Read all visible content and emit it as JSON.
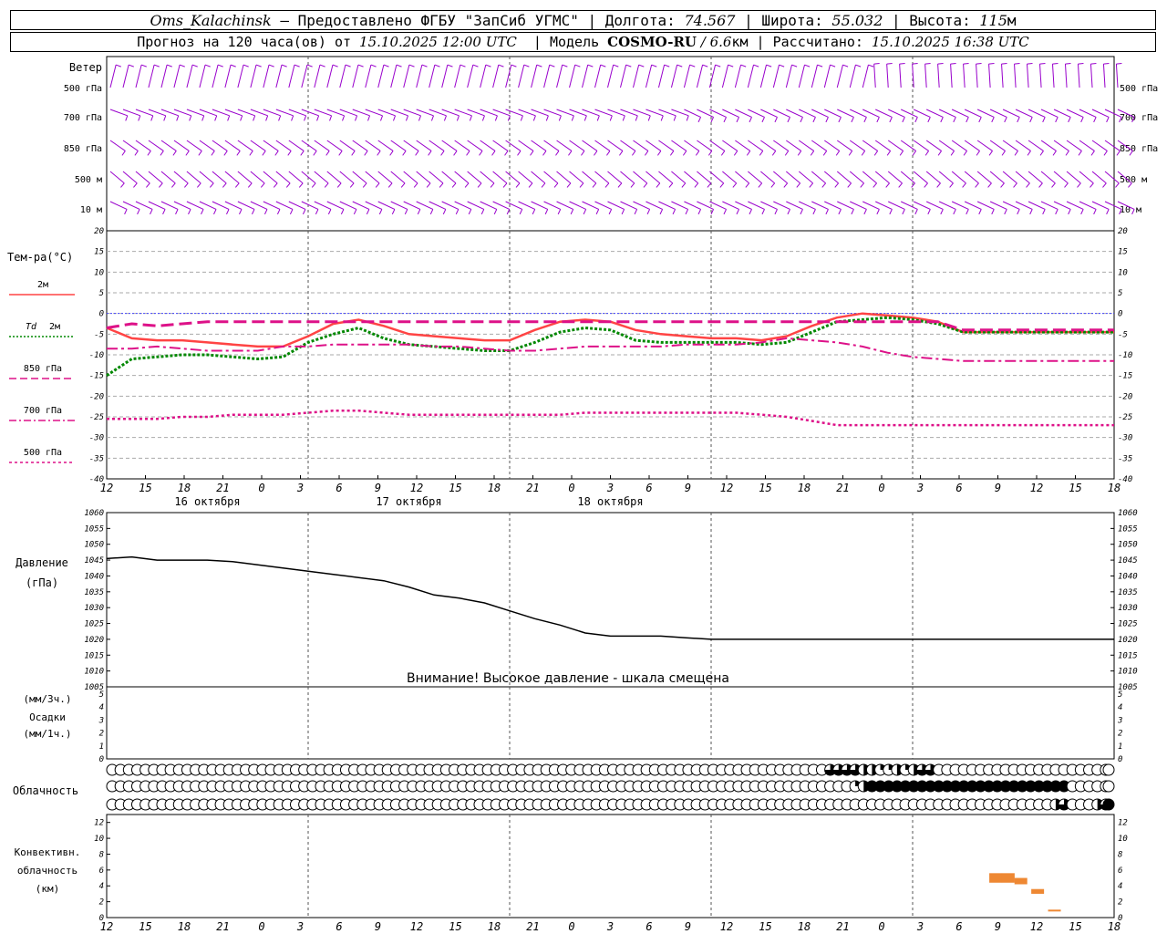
{
  "header": {
    "station": "Oms_Kalachinsk",
    "provider": " — Предоставлено ФГБУ \"ЗапСиб УГМС\" | Долгота: ",
    "lon": "74.567",
    "lat_label": " | Широта: ",
    "lat": "55.032",
    "alt_label": " | Высота: ",
    "alt": "115",
    "alt_unit": "м",
    "forecast_label": "Прогноз на 120 часа(ов) от ",
    "run_time": "15.10.2025 12:00 UTC",
    "model_label": "  | Модель ",
    "model": "COSMO-RU",
    "resolution": " / 6.6",
    "res_unit": "км",
    "calc_label": " | Рассчитано: ",
    "calc_time": "15.10.2025 16:38 UTC"
  },
  "labels": {
    "wind": "Ветер",
    "wind_levels": [
      "500 гПа",
      "700 гПа",
      "850 гПа",
      "500 м",
      "10 м"
    ],
    "temp_title": "Тем-ра(°С)",
    "legend_2m": "2м",
    "legend_td": "Td",
    "legend_td2": "2м",
    "legend_850": "850 гПа",
    "legend_700": "700 гПа",
    "legend_500": "500 гПа",
    "pressure_title": "Давление",
    "pressure_unit": "(гПа)",
    "warning": "Внимание! Высокое давление - шкала смещена",
    "precip_unit3": "(мм/3ч.)",
    "precip_title": "Осадки",
    "precip_unit1": "(мм/1ч.)",
    "cloud_title": "Облачность",
    "conv_title1": "Конвективн.",
    "conv_title2": "облачность",
    "conv_unit": "(км)"
  },
  "colors": {
    "t2m": "#ff4444",
    "td2m": "#008800",
    "t850": "#dd1188",
    "t700": "#dd1188",
    "t500": "#dd1188",
    "zero_line": "#4444ff",
    "wind": "#9900cc",
    "conv": "#ee8833"
  },
  "chart_data": [
    {
      "type": "line",
      "title": "Тем-ра(°С)",
      "x_hours": [
        0,
        3,
        6,
        9,
        12,
        15,
        18,
        21,
        24,
        27,
        30,
        33,
        36,
        39,
        42,
        45,
        48,
        51,
        54,
        57,
        60,
        63,
        66,
        69,
        72,
        75,
        78,
        81,
        84,
        87,
        90,
        93,
        96,
        99,
        102,
        105,
        108,
        111,
        114,
        117,
        120
      ],
      "x_ticks": [
        "12",
        "15",
        "18",
        "21",
        "0",
        "3",
        "6",
        "9",
        "12",
        "15",
        "18",
        "21",
        "0",
        "3",
        "6",
        "9",
        "12",
        "15",
        "18",
        "21",
        "0",
        "3",
        "6",
        "9",
        "12",
        "15",
        "18"
      ],
      "dates": [
        "16 октября",
        "17 октября",
        "18 октября"
      ],
      "ylim": [
        -40,
        20
      ],
      "yticks": [
        20,
        15,
        10,
        5,
        0,
        -5,
        -10,
        -15,
        -20,
        -25,
        -30,
        -35,
        -40
      ],
      "series": [
        {
          "name": "2м",
          "values": [
            -3.5,
            -6,
            -6.5,
            -6.5,
            -7,
            -7.5,
            -8,
            -8,
            -5.5,
            -2.5,
            -1.5,
            -3,
            -5,
            -5.5,
            -6,
            -6.5,
            -6.5,
            -4,
            -2,
            -1.5,
            -2,
            -4,
            -5,
            -5.5,
            -6,
            -6,
            -6.5,
            -5.5,
            -3,
            -1,
            0,
            -0.5,
            -1,
            -2,
            -4.5,
            -4.5,
            -4.5,
            -4.5,
            -4.5,
            -4.5,
            -4.5
          ]
        },
        {
          "name": "Td 2м",
          "values": [
            -15,
            -11,
            -10.5,
            -10,
            -10,
            -10.5,
            -11,
            -10.5,
            -7,
            -5,
            -3.5,
            -6,
            -7.5,
            -8,
            -8.5,
            -9,
            -9,
            -7,
            -4.5,
            -3.5,
            -4,
            -6.5,
            -7,
            -7,
            -7,
            -7,
            -7.5,
            -7,
            -4.5,
            -2,
            -1.5,
            -1,
            -1.5,
            -2.5,
            -4.5,
            -4.5,
            -4.5,
            -4.5,
            -4.5,
            -4.5,
            -4.5
          ]
        },
        {
          "name": "850 гПа",
          "values": [
            -3.5,
            -2.5,
            -3,
            -2.5,
            -2,
            -2,
            -2,
            -2,
            -2,
            -2,
            -2,
            -2,
            -2,
            -2,
            -2,
            -2,
            -2,
            -2,
            -2,
            -2,
            -2,
            -2,
            -2,
            -2,
            -2,
            -2,
            -2,
            -2,
            -2,
            -2,
            -2,
            -2,
            -2,
            -2,
            -4,
            -4,
            -4,
            -4,
            -4,
            -4,
            -4
          ]
        },
        {
          "name": "700 гПа",
          "values": [
            -8.5,
            -8.5,
            -8,
            -8.5,
            -9,
            -9,
            -9,
            -8,
            -8,
            -7.5,
            -7.5,
            -7.5,
            -7.5,
            -8,
            -8,
            -8.5,
            -9,
            -9,
            -8.5,
            -8,
            -8,
            -8,
            -8,
            -7.5,
            -7.5,
            -7.5,
            -7,
            -6,
            -6.5,
            -7,
            -8,
            -9.5,
            -10.5,
            -11,
            -11.5,
            -11.5,
            -11.5,
            -11.5,
            -11.5,
            -11.5,
            -11.5
          ]
        },
        {
          "name": "500 гПа",
          "values": [
            -25.5,
            -25.5,
            -25.5,
            -25,
            -25,
            -24.5,
            -24.5,
            -24.5,
            -24,
            -23.5,
            -23.5,
            -24,
            -24.5,
            -24.5,
            -24.5,
            -24.5,
            -24.5,
            -24.5,
            -24.5,
            -24,
            -24,
            -24,
            -24,
            -24,
            -24,
            -24,
            -24.5,
            -25,
            -26,
            -27,
            -27,
            -27,
            -27,
            -27,
            -27,
            -27,
            -27,
            -27,
            -27,
            -27,
            -27
          ]
        }
      ]
    },
    {
      "type": "line",
      "title": "Давление",
      "ylabel": "(гПа)",
      "ylim": [
        1005,
        1060
      ],
      "yticks": [
        1060,
        1055,
        1050,
        1045,
        1040,
        1035,
        1030,
        1025,
        1020,
        1015,
        1010,
        1005
      ],
      "series": [
        {
          "name": "Давление",
          "values": [
            1045.5,
            1046,
            1045,
            1045,
            1045,
            1044.5,
            1043.5,
            1042.5,
            1041.5,
            1040.5,
            1039.5,
            1038.5,
            1036.5,
            1034,
            1033,
            1031.5,
            1029,
            1026.5,
            1024.5,
            1022,
            1021,
            1021,
            1021,
            1020.5,
            1020,
            1020,
            1020,
            1020,
            1020,
            1020,
            1020,
            1020,
            1020,
            1020,
            1020,
            1020,
            1020,
            1020,
            1020,
            1020,
            1020
          ]
        }
      ]
    },
    {
      "type": "bar",
      "title": "Осадки",
      "ylim": [
        0,
        5
      ],
      "yticks": [
        5,
        4,
        3,
        2,
        1,
        0
      ],
      "values": []
    },
    {
      "type": "bar",
      "title": "Конвективн. облачность",
      "ylabel": "(км)",
      "ylim": [
        0,
        13
      ],
      "yticks": [
        12,
        10,
        8,
        6,
        4,
        2,
        0
      ],
      "segments": [
        {
          "x": 106,
          "bottom": 4.4,
          "top": 5.6
        },
        {
          "x": 107.5,
          "bottom": 4.4,
          "top": 5.6
        },
        {
          "x": 109,
          "bottom": 4.2,
          "top": 5.0
        },
        {
          "x": 111,
          "bottom": 3.0,
          "top": 3.6
        },
        {
          "x": 113,
          "bottom": 0.8,
          "top": 1.0
        }
      ]
    }
  ],
  "clouds": {
    "upper": [
      0,
      0,
      0,
      0,
      0,
      0,
      0,
      0,
      0,
      0,
      0,
      0,
      0,
      0,
      0,
      0,
      0,
      0,
      0,
      0,
      0,
      0,
      0,
      0,
      0,
      0,
      0,
      0,
      0,
      0,
      0,
      0,
      0,
      0,
      0,
      0,
      0,
      0,
      0,
      0,
      0,
      0,
      0,
      0,
      0,
      0,
      0,
      0,
      0,
      0,
      0,
      0,
      0,
      0,
      0,
      0,
      0,
      0,
      0,
      0,
      0,
      0,
      0,
      0,
      0,
      0,
      0,
      0,
      0,
      0,
      0,
      0,
      0,
      0,
      0,
      0,
      0,
      0,
      0,
      0,
      0,
      0,
      0,
      0,
      0,
      0,
      0,
      0,
      0,
      0,
      0,
      0,
      0,
      0,
      0,
      0,
      0,
      0,
      0,
      0,
      0,
      0,
      0,
      0,
      0,
      0,
      0,
      0,
      0,
      0,
      0,
      0,
      0,
      0,
      0,
      0,
      0,
      0,
      0,
      0,
      0,
      0,
      0,
      0,
      0,
      0,
      0,
      0,
      0,
      0,
      0,
      0,
      0,
      0,
      0,
      0,
      0,
      0,
      0,
      0,
      0,
      0,
      0,
      0,
      0,
      0,
      0,
      0,
      0,
      0,
      0,
      0,
      0,
      0,
      0,
      0,
      0,
      0,
      0,
      0,
      0,
      0,
      0,
      0,
      0,
      0,
      0,
      0,
      0,
      0,
      0,
      0,
      0,
      0,
      0,
      0,
      0,
      0,
      0,
      0,
      0,
      0,
      0,
      0,
      0,
      0,
      0,
      0,
      0,
      0,
      0,
      0,
      0,
      0,
      0,
      0,
      0,
      0,
      0,
      0,
      0,
      0,
      0,
      0,
      0,
      0,
      0,
      0,
      0,
      0,
      0,
      0,
      0,
      0,
      0,
      0,
      0,
      0,
      0,
      0,
      0,
      0,
      0,
      0,
      0,
      0,
      0,
      0,
      0,
      0,
      0,
      0,
      0,
      0,
      0,
      0,
      0,
      0,
      0,
      0,
      0,
      0,
      0,
      0,
      0,
      0,
      0
    ],
    "upper_cells": [
      0,
      0,
      0,
      0,
      0,
      0,
      0,
      0,
      0,
      0,
      0,
      0,
      0,
      0,
      0,
      0,
      0,
      0,
      0,
      0,
      0,
      0,
      0,
      0,
      0,
      0,
      0,
      0,
      0,
      0,
      0,
      0,
      0,
      0,
      0,
      0,
      0,
      0,
      0,
      0,
      0,
      0,
      0,
      0,
      0,
      0,
      0,
      0,
      0,
      0,
      0,
      0,
      0,
      0,
      0,
      0,
      0,
      0,
      0,
      0,
      0,
      0,
      0,
      0,
      0,
      0,
      0,
      0,
      0,
      0,
      0,
      0,
      0,
      0,
      0,
      0,
      0,
      0,
      0,
      0,
      0,
      0,
      0,
      0,
      0,
      0,
      0,
      0,
      0,
      0,
      0,
      0,
      0,
      0,
      0,
      0,
      0,
      0,
      0,
      0,
      0,
      0,
      0,
      0,
      0,
      0,
      0,
      0,
      0,
      0,
      0,
      0,
      0,
      0,
      0,
      0,
      0,
      0,
      0,
      0,
      0,
      0,
      0,
      0,
      0,
      0,
      0,
      0,
      0,
      0,
      0,
      0,
      0,
      0,
      0,
      0,
      0,
      0,
      0,
      0,
      0,
      0,
      0,
      0,
      0,
      0,
      0,
      0,
      0,
      0,
      0,
      0,
      0,
      0,
      0,
      0,
      0,
      0,
      0,
      0,
      0,
      0,
      0,
      0,
      0,
      0,
      0,
      0,
      0,
      0,
      0,
      0,
      0,
      0,
      0,
      0,
      0,
      0,
      0,
      0,
      0,
      0,
      0,
      0,
      0,
      0,
      0,
      0,
      0,
      0,
      0,
      0,
      0,
      0,
      0,
      0,
      0,
      0,
      0,
      0,
      0,
      0,
      0,
      0,
      0,
      0,
      0,
      0,
      0,
      0,
      0,
      0,
      0,
      0,
      0,
      0,
      0,
      0,
      0,
      0,
      0,
      0,
      0,
      0,
      0,
      0,
      0,
      0,
      0,
      0,
      0,
      0,
      0,
      0,
      0,
      0,
      0,
      0,
      0,
      0,
      0,
      0,
      0,
      0,
      0,
      0,
      0
    ],
    "high": [
      0,
      0,
      0,
      0,
      0,
      0,
      0,
      0,
      0,
      0,
      0,
      0,
      0,
      0,
      0,
      0,
      0,
      0,
      0,
      0,
      0,
      0,
      0,
      0,
      0,
      0,
      0,
      0,
      0,
      0,
      0,
      0,
      0,
      0,
      0,
      0,
      0,
      0,
      0,
      0,
      0,
      0,
      0,
      0,
      0,
      0,
      0,
      0,
      0,
      0,
      0,
      0,
      0,
      0,
      0,
      0,
      0,
      0,
      0,
      0,
      0,
      0,
      0,
      0,
      0,
      0,
      0,
      0,
      0,
      0,
      0,
      0,
      0,
      0,
      0,
      0,
      0,
      0,
      0,
      0,
      0,
      0,
      0,
      0,
      0,
      0,
      0,
      0,
      0,
      0,
      0,
      0,
      0,
      0,
      0,
      0,
      0,
      0,
      0,
      0,
      0,
      0,
      0,
      0,
      0,
      0,
      0,
      0,
      0,
      0,
      0,
      0,
      0,
      0,
      0,
      0,
      0,
      0,
      0,
      0,
      0,
      0,
      0,
      0,
      0,
      0,
      0,
      0,
      0,
      0,
      0,
      0,
      0,
      0,
      0,
      0,
      0,
      0,
      0,
      0,
      0,
      0,
      0,
      0,
      0,
      0,
      0,
      0,
      0,
      0,
      0,
      0,
      0,
      0,
      0,
      0,
      0,
      0,
      0,
      0,
      0,
      0,
      0,
      0,
      0,
      0,
      0,
      0,
      0,
      0,
      0,
      0,
      0,
      0,
      0,
      0,
      0,
      0,
      0,
      0,
      0,
      0,
      0,
      0,
      0,
      0,
      0,
      0,
      0,
      0,
      0,
      0,
      0,
      0,
      0,
      0,
      0,
      0,
      0,
      0,
      0,
      0,
      0,
      0,
      0,
      0,
      0,
      0,
      0,
      0,
      0,
      0,
      0,
      0,
      0,
      0,
      0,
      0,
      0,
      0,
      0,
      0,
      0,
      0,
      0,
      0,
      0,
      0,
      0,
      0,
      0,
      0,
      0,
      0,
      0,
      0,
      0,
      0,
      0,
      0,
      0,
      0,
      0,
      0,
      0,
      0,
      0
    ],
    "row_high": [
      0,
      0,
      0,
      0,
      0,
      0,
      0,
      0,
      0,
      0,
      0,
      0,
      0,
      0,
      0,
      0,
      0,
      0,
      0,
      0,
      0,
      0,
      0,
      0,
      0,
      0,
      0,
      0,
      0,
      0,
      0,
      0,
      0,
      0,
      0,
      0,
      0,
      0,
      0,
      0,
      0,
      0,
      0,
      0,
      0,
      0,
      0,
      0,
      0,
      0,
      0,
      0,
      0,
      0,
      0,
      0,
      0,
      0,
      0,
      0,
      0,
      0,
      0,
      0,
      0,
      0,
      0,
      0,
      0,
      0,
      0,
      0,
      0,
      0,
      0,
      0,
      0,
      0,
      0,
      0,
      0,
      0,
      0,
      0,
      0,
      0,
      0.75,
      0.75,
      0.75,
      0.75,
      0.5,
      0.5,
      0.25,
      0.25,
      0.5,
      0.25,
      0.5,
      0.75,
      0.75,
      0,
      0,
      0,
      0,
      0,
      0,
      0,
      0,
      0,
      0,
      0,
      0,
      0,
      0,
      0,
      0,
      0,
      0,
      0,
      0,
      0,
      0
    ],
    "row_mid": [
      0,
      0,
      0,
      0,
      0,
      0,
      0,
      0,
      0,
      0,
      0,
      0,
      0,
      0,
      0,
      0,
      0,
      0,
      0,
      0,
      0,
      0,
      0,
      0,
      0,
      0,
      0,
      0,
      0,
      0,
      0,
      0,
      0,
      0,
      0,
      0,
      0,
      0,
      0,
      0,
      0,
      0,
      0,
      0,
      0,
      0,
      0,
      0,
      0,
      0,
      0,
      0,
      0,
      0,
      0,
      0,
      0,
      0,
      0,
      0,
      0,
      0,
      0,
      0,
      0,
      0,
      0,
      0,
      0,
      0,
      0,
      0,
      0,
      0,
      0,
      0,
      0,
      0,
      0,
      0,
      0,
      0,
      0,
      0,
      0,
      0,
      0,
      0,
      0,
      0.25,
      0.5,
      1,
      1,
      1,
      1,
      1,
      1,
      1,
      1,
      1,
      1,
      1,
      1,
      1,
      1,
      1,
      1,
      1,
      1,
      1,
      1,
      1,
      1,
      1,
      1,
      0,
      0,
      0,
      0,
      0,
      0
    ],
    "row_low": [
      0,
      0,
      0,
      0,
      0,
      0,
      0,
      0,
      0,
      0,
      0,
      0,
      0,
      0,
      0,
      0,
      0,
      0,
      0,
      0,
      0,
      0,
      0,
      0,
      0,
      0,
      0,
      0,
      0,
      0,
      0,
      0,
      0,
      0,
      0,
      0,
      0,
      0,
      0,
      0,
      0,
      0,
      0,
      0,
      0,
      0,
      0,
      0,
      0,
      0,
      0,
      0,
      0,
      0,
      0,
      0,
      0,
      0,
      0,
      0,
      0,
      0,
      0,
      0,
      0,
      0,
      0,
      0,
      0,
      0,
      0,
      0,
      0,
      0,
      0,
      0,
      0,
      0,
      0,
      0,
      0,
      0,
      0,
      0,
      0,
      0,
      0,
      0,
      0,
      0,
      0,
      0,
      0,
      0,
      0,
      0,
      0,
      0,
      0,
      0,
      0,
      0,
      0,
      0,
      0,
      0,
      0,
      0,
      0,
      0,
      0,
      0,
      0,
      0.5,
      0.75,
      0,
      0,
      0,
      0.5,
      0.75,
      1
    ]
  }
}
